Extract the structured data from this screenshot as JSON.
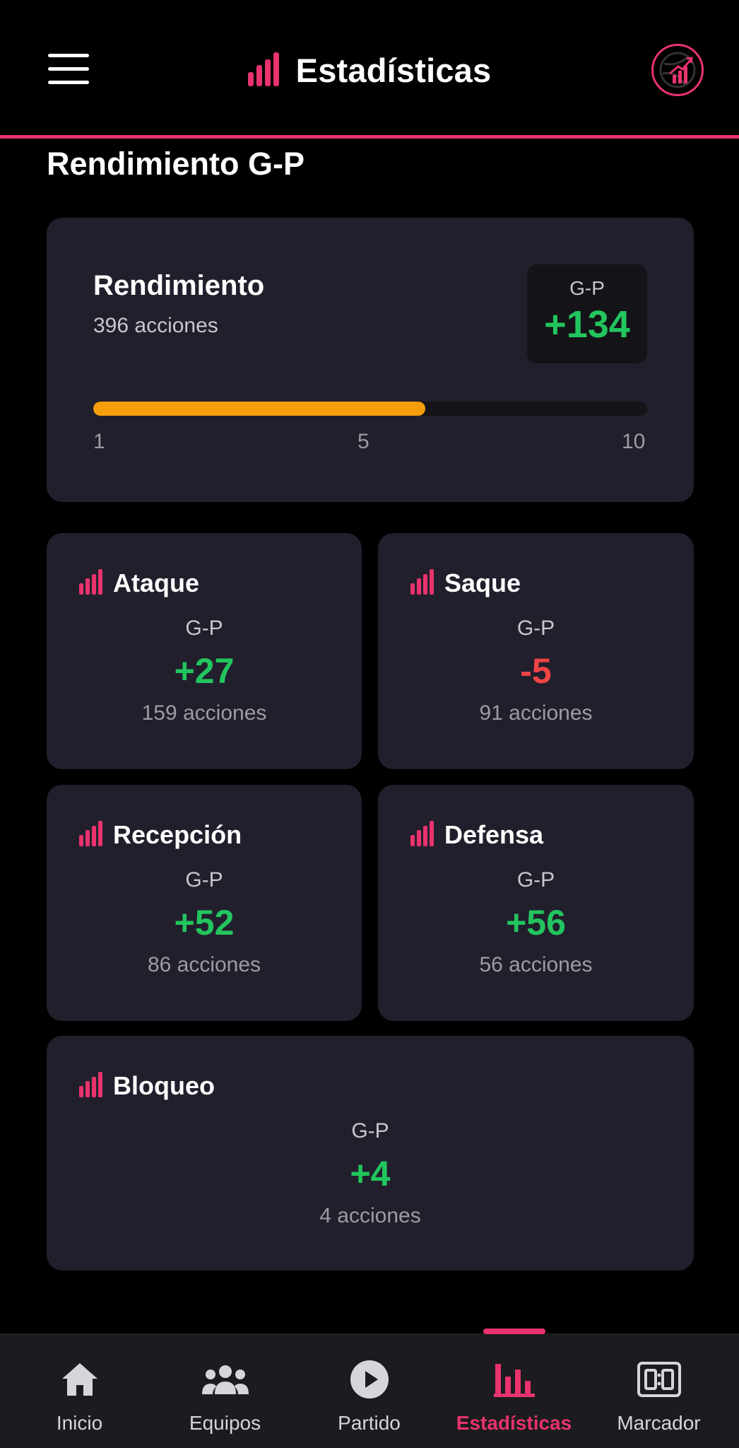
{
  "header": {
    "title": "Estadísticas",
    "accent_color": "#e8336d",
    "left_icon": "hamburger-menu-icon",
    "right_icon": "volleyball-stats-logo-icon"
  },
  "section_title": "Rendimiento G-P",
  "summary": {
    "title": "Rendimiento",
    "actions": "396 acciones",
    "gp_label": "G-P",
    "gp_value": "+134",
    "progress_fraction": 0.6,
    "progress_color": "#f59e0b",
    "scale": {
      "min": "1",
      "mid": "5",
      "max": "10"
    }
  },
  "stats": [
    {
      "name": "Ataque",
      "gp_label": "G-P",
      "value": "+27",
      "actions": "159 acciones",
      "sign": "positive"
    },
    {
      "name": "Saque",
      "gp_label": "G-P",
      "value": "-5",
      "actions": "91 acciones",
      "sign": "negative"
    },
    {
      "name": "Recepción",
      "gp_label": "G-P",
      "value": "+52",
      "actions": "86 acciones",
      "sign": "positive"
    },
    {
      "name": "Defensa",
      "gp_label": "G-P",
      "value": "+56",
      "actions": "56 acciones",
      "sign": "positive"
    },
    {
      "name": "Bloqueo",
      "gp_label": "G-P",
      "value": "+4",
      "actions": "4 acciones",
      "sign": "positive"
    }
  ],
  "colors": {
    "positive": "#22c55e",
    "negative": "#ef4444",
    "card": "#221f2d"
  },
  "nav": [
    {
      "label": "Inicio",
      "icon": "home-icon",
      "active": false
    },
    {
      "label": "Equipos",
      "icon": "team-icon",
      "active": false
    },
    {
      "label": "Partido",
      "icon": "play-icon",
      "active": false
    },
    {
      "label": "Estadísticas",
      "icon": "bar-chart-icon",
      "active": true
    },
    {
      "label": "Marcador",
      "icon": "scoreboard-icon",
      "active": false
    }
  ]
}
